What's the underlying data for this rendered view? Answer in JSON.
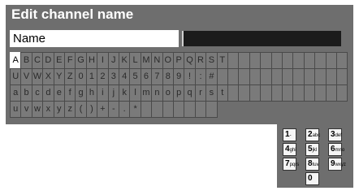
{
  "dialog": {
    "title": "Edit channel name",
    "name_label": "Name",
    "name_value": ""
  },
  "keyboard": {
    "selected_key": "A",
    "rows": [
      [
        "A",
        "B",
        "C",
        "D",
        "E",
        "F",
        "G",
        "H",
        "I",
        "J",
        "K",
        "L",
        "M",
        "N",
        "O",
        "P",
        "Q",
        "R",
        "S",
        "T",
        "",
        "",
        "",
        "",
        "",
        "",
        "",
        "",
        "",
        "",
        ""
      ],
      [
        "U",
        "V",
        "W",
        "X",
        "Y",
        "Z",
        "0",
        "1",
        "2",
        "3",
        "4",
        "5",
        "6",
        "7",
        "8",
        "9",
        "!",
        ":",
        "#",
        "",
        "",
        "",
        "",
        "",
        "",
        "",
        "",
        "",
        "",
        "",
        ""
      ],
      [
        "a",
        "b",
        "c",
        "d",
        "e",
        "f",
        "g",
        "h",
        "i",
        "j",
        "k",
        "l",
        "m",
        "n",
        "o",
        "p",
        "q",
        "r",
        "s",
        "t",
        "",
        "",
        "",
        "",
        "",
        "",
        "",
        "",
        "",
        "",
        ""
      ],
      [
        "u",
        "v",
        "w",
        "x",
        "y",
        "z",
        "(",
        ")",
        "+",
        "-",
        ".",
        "*",
        "",
        "",
        "",
        "",
        "",
        "",
        ""
      ]
    ]
  },
  "numpad": {
    "keys": [
      {
        "digit": "1",
        "sub": "-"
      },
      {
        "digit": "2",
        "sub": "abc"
      },
      {
        "digit": "3",
        "sub": "def"
      },
      {
        "digit": "4",
        "sub": "ghi"
      },
      {
        "digit": "5",
        "sub": "jkl"
      },
      {
        "digit": "6",
        "sub": "mno"
      },
      {
        "digit": "7",
        "sub": "pqrs"
      },
      {
        "digit": "8",
        "sub": "tuv"
      },
      {
        "digit": "9",
        "sub": "wxyz"
      },
      {
        "digit": "0",
        "sub": ""
      }
    ]
  },
  "colors": {
    "panel": "#6e6e6e",
    "key_border": "#4a4a4a",
    "selected_key": "#ffffff",
    "field_bg": "#1b1b1b"
  }
}
